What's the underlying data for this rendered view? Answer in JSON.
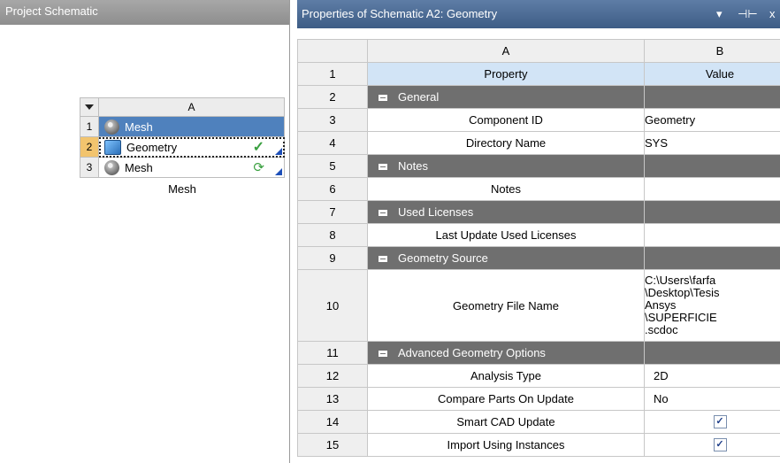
{
  "left_pane": {
    "title": "Project Schematic",
    "system": {
      "col_header": "A",
      "rows": [
        {
          "num": "1",
          "label": "Mesh"
        },
        {
          "num": "2",
          "label": "Geometry",
          "status": "✓"
        },
        {
          "num": "3",
          "label": "Mesh",
          "status": "⟳"
        }
      ],
      "caption": "Mesh"
    }
  },
  "properties": {
    "title": "Properties of Schematic A2: Geometry",
    "controls": {
      "dropdown": "▾",
      "pin": "⊣⊢",
      "close": "x"
    },
    "columns": {
      "a": "A",
      "b": "B"
    },
    "header_row": {
      "num": "1",
      "property": "Property",
      "value": "Value"
    },
    "rows": [
      {
        "num": "2",
        "section": "General"
      },
      {
        "num": "3",
        "property": "Component ID",
        "value": "Geometry"
      },
      {
        "num": "4",
        "property": "Directory Name",
        "value": "SYS"
      },
      {
        "num": "5",
        "section": "Notes"
      },
      {
        "num": "6",
        "property": "Notes",
        "value": ""
      },
      {
        "num": "7",
        "section": "Used Licenses"
      },
      {
        "num": "8",
        "property": "Last Update Used Licenses",
        "value": ""
      },
      {
        "num": "9",
        "section": "Geometry Source"
      },
      {
        "num": "10",
        "property": "Geometry File Name",
        "value_lines": [
          "C:\\Users\\farfa",
          "\\Desktop\\Tesis",
          "Ansys",
          "\\SUPERFICIE",
          ".scdoc"
        ]
      },
      {
        "num": "11",
        "section": "Advanced Geometry Options"
      },
      {
        "num": "12",
        "property": "Analysis Type",
        "value": "2D",
        "control": "combo"
      },
      {
        "num": "13",
        "property": "Compare Parts On Update",
        "value": "No",
        "control": "combo"
      },
      {
        "num": "14",
        "property": "Smart CAD Update",
        "control": "checkbox",
        "checked": true
      },
      {
        "num": "15",
        "property": "Import Using Instances",
        "control": "checkbox",
        "checked": true
      }
    ]
  },
  "colors": {
    "header_blue": "#4a6a95",
    "section_gray": "#6f6f6f",
    "selection_blue": "#4f81bd",
    "prop_header": "#d2e4f6",
    "highlight_row": "#f2c46e"
  }
}
